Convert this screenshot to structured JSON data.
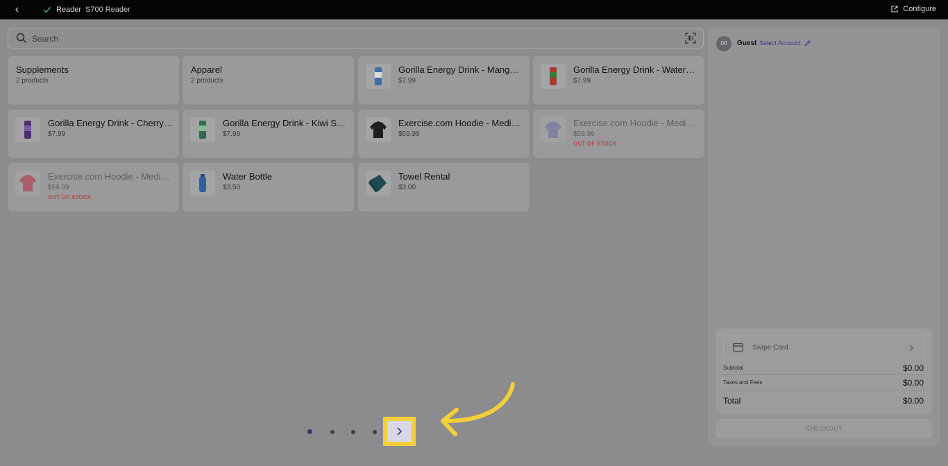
{
  "topbar": {
    "reader_label": "Reader",
    "reader_name": "S700 Reader",
    "configure_label": "Configure"
  },
  "search": {
    "placeholder": "Search"
  },
  "tiles": [
    {
      "name": "Supplements",
      "price": "2 products",
      "oos": ""
    },
    {
      "name": "Apparel",
      "price": "2 products",
      "oos": ""
    },
    {
      "name": "Gorilla Energy Drink - Mango ...",
      "price": "$7.99",
      "oos": ""
    },
    {
      "name": "Gorilla Energy Drink - Waterm...",
      "price": "$7.99",
      "oos": ""
    },
    {
      "name": "Gorilla Energy Drink - Cherry ...",
      "price": "$7.99",
      "oos": ""
    },
    {
      "name": "Gorilla Energy Drink - Kiwi Stra...",
      "price": "$7.99",
      "oos": ""
    },
    {
      "name": "Exercise.com Hoodie - Mediu...",
      "price": "$59.99",
      "oos": ""
    },
    {
      "name": "Exercise.com Hoodie - Mediu...",
      "price": "$59.99",
      "oos": "OUT OF STOCK"
    },
    {
      "name": "Exercise.com Hoodie - Mediu...",
      "price": "$59.99",
      "oos": "OUT OF STOCK"
    },
    {
      "name": "Water Bottle",
      "price": "$3.50",
      "oos": ""
    },
    {
      "name": "Towel Rental",
      "price": "$3.00",
      "oos": ""
    }
  ],
  "pagination": {
    "page_count": 4,
    "active_page": 1
  },
  "cart": {
    "avatar_initials": "00",
    "customer": "Guest",
    "select_account": "Select Account",
    "swipe_card": "Swipe Card",
    "subtotal_label": "Subtotal",
    "subtotal_value": "$0.00",
    "taxes_label": "Taxes and Fees",
    "taxes_value": "$0.00",
    "total_label": "Total",
    "total_value": "$0.00",
    "checkout_label": "CHECKOUT"
  },
  "colors": {
    "accent": "#3b3a8a",
    "highlight": "#f5cf3a",
    "out_of_stock": "#b24b4b"
  }
}
